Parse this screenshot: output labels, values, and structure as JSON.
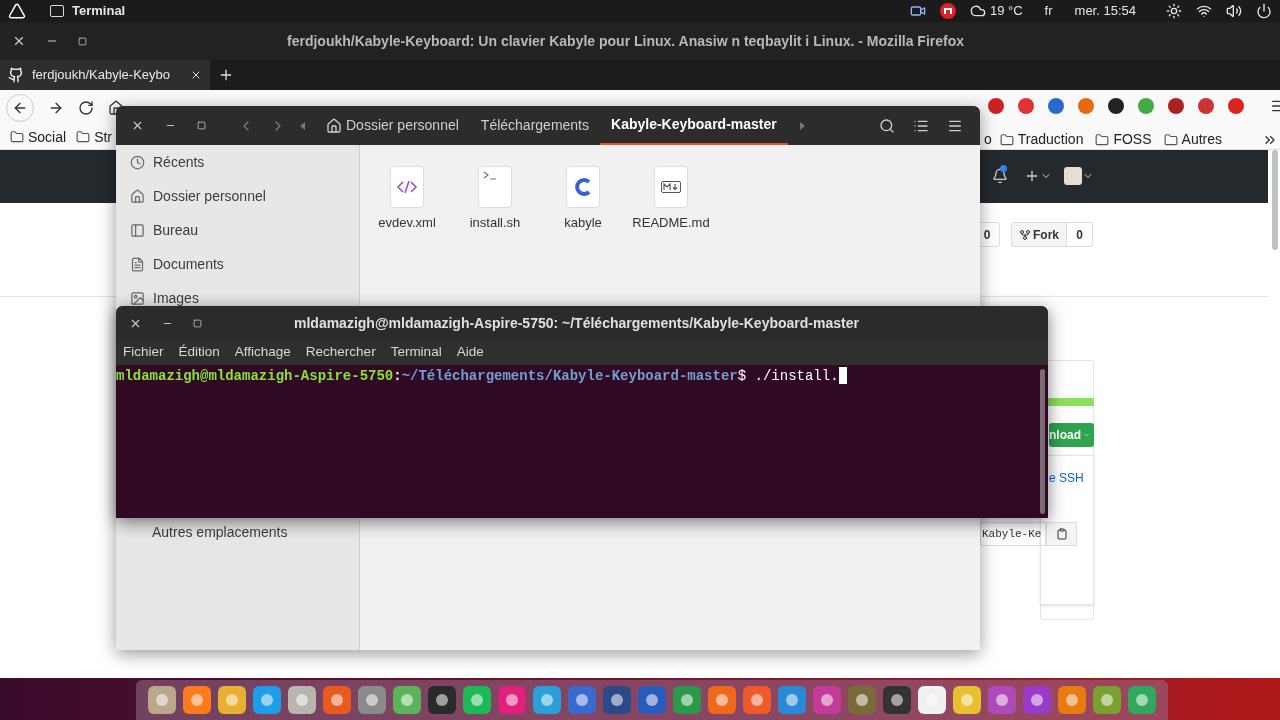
{
  "top_bar": {
    "app_menu": "Terminal",
    "temperature": "19 °C",
    "keyboard_layout": "fr",
    "clock": "mer. 15:54"
  },
  "browser": {
    "title": "ferdjoukh/Kabyle-Keyboard: Un clavier Kabyle pour Linux. Anasiw n teqbaylit i Linux. - Mozilla Firefox",
    "tab": {
      "label": "ferdjoukh/Kabyle-Keybo"
    },
    "bookmarks_left": [
      "Social",
      "Str"
    ],
    "bookmark_cut": "o",
    "bookmarks_right": [
      "Traduction",
      "FOSS",
      "Autres"
    ],
    "page": {
      "star_count": "0",
      "fork_label": "Fork",
      "fork_count": "0",
      "download_label": "nload",
      "ssh_link": "e SSH",
      "clone_url": "Kabyle-Ke"
    }
  },
  "file_manager": {
    "path": [
      {
        "label": "Dossier personnel",
        "kind": "home",
        "selected": false
      },
      {
        "label": "Téléchargements",
        "kind": "folder",
        "selected": false
      },
      {
        "label": "Kabyle-Keyboard-master",
        "kind": "folder",
        "selected": true
      }
    ],
    "sidebar": [
      {
        "label": "Récents",
        "kind": "recent"
      },
      {
        "label": "Dossier personnel",
        "kind": "home"
      },
      {
        "label": "Bureau",
        "kind": "desktop"
      },
      {
        "label": "Documents",
        "kind": "documents"
      },
      {
        "label": "Images",
        "kind": "pictures"
      }
    ],
    "other_places": "Autres emplacements",
    "files": [
      {
        "name": "evdev.xml",
        "kind": "code"
      },
      {
        "name": "install.sh",
        "kind": "script"
      },
      {
        "name": "kabyle",
        "kind": "c"
      },
      {
        "name": "README.md",
        "kind": "markdown"
      }
    ]
  },
  "terminal": {
    "title": "mldamazigh@mldamazigh-Aspire-5750: ~/Téléchargements/Kabyle-Keyboard-master",
    "menu": [
      "Fichier",
      "Édition",
      "Affichage",
      "Rechercher",
      "Terminal",
      "Aide"
    ],
    "prompt_user": "mldamazigh@mldamazigh-Aspire-5750",
    "prompt_separator": ":",
    "prompt_path": "~/Téléchargements/Kabyle-Keyboard-master",
    "prompt_symbol": "$",
    "command": "./install."
  }
}
